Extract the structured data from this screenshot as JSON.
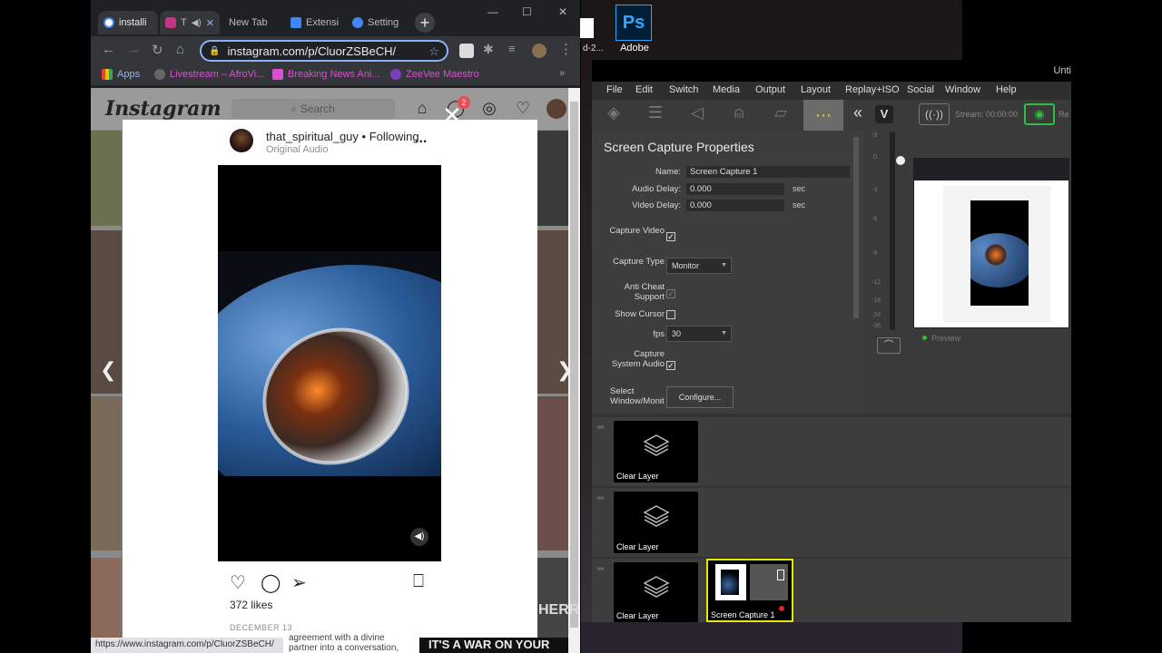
{
  "desktop": {
    "ps_label": "Adobe",
    "side_text": "d-2..."
  },
  "chrome": {
    "tabs": [
      {
        "label": "installi",
        "color": "#ffffff"
      },
      {
        "label": "T",
        "color": "#c13584"
      },
      {
        "label": "New Tab",
        "color": "#888888"
      },
      {
        "label": "Extensi",
        "color": "#4285f4"
      },
      {
        "label": "Setting",
        "color": "#4285f4"
      }
    ],
    "url": "instagram.com/p/CluorZSBeCH/",
    "bookmarks": [
      {
        "label": "Apps",
        "color": "#ea4335"
      },
      {
        "label": "Livestream – AfroVi...",
        "color": "#666666"
      },
      {
        "label": "Breaking News Ani...",
        "color": "#d94fd5"
      },
      {
        "label": "ZeeVee Maestro",
        "color": "#7a3fbf"
      }
    ],
    "status_url": "https://www.instagram.com/p/CluorZSBeCH/"
  },
  "instagram": {
    "logo": "Instagram",
    "search_placeholder": "Search",
    "badge": "2",
    "post": {
      "username": "that_spiritual_guy",
      "following": "• Following",
      "audio": "Original Audio",
      "more": "...",
      "likes": "372 likes",
      "date": "DECEMBER 13"
    },
    "bg_texts": {
      "under": "agreement with a divine partner into a conversation, that will",
      "war": "IT'S A WAR ON YOUR",
      "herr": "HERR"
    }
  },
  "vmix": {
    "title": "Unti",
    "menu": [
      "File",
      "Edit",
      "Switch",
      "Media",
      "Output",
      "Layout",
      "Replay+ISO",
      "Social",
      "Window",
      "Help"
    ],
    "stream_label": "Stream: 00:00:00",
    "rec_label": "Re",
    "preview_label": "Preview",
    "properties": {
      "title": "Screen Capture Properties",
      "name_label": "Name:",
      "name_value": "Screen Capture 1",
      "audio_delay_label": "Audio Delay:",
      "audio_delay_value": "0.000",
      "video_delay_label": "Video Delay:",
      "video_delay_value": "0.000",
      "sec": "sec",
      "capture_video_label": "Capture Video",
      "capture_type_label": "Capture Type",
      "capture_type_value": "Monitor",
      "anti_cheat_label_1": "Anti Cheat",
      "anti_cheat_label_2": "Support",
      "show_cursor_label": "Show Cursor",
      "fps_label": "fps",
      "fps_value": "30",
      "system_audio_label_1": "Capture",
      "system_audio_label_2": "System Audio",
      "select_window_label_1": "Select",
      "select_window_label_2": "Window/Monit",
      "configure_button": "Configure..."
    },
    "meter_ticks": [
      "-9",
      "0",
      "-3",
      "-6",
      "-9",
      "-12",
      "-18",
      "-24",
      "-36"
    ],
    "layers": [
      {
        "label": "Clear Layer"
      },
      {
        "label": "Clear Layer"
      },
      {
        "label": "Clear Layer"
      }
    ],
    "screen_capture_input": "Screen Capture 1"
  }
}
